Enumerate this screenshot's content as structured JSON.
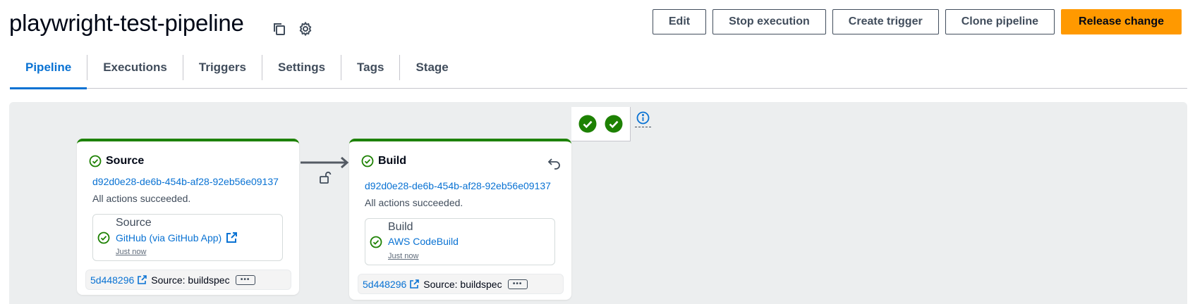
{
  "header": {
    "title": "playwright-test-pipeline",
    "actions": {
      "edit": "Edit",
      "stop": "Stop execution",
      "create_trigger": "Create trigger",
      "clone": "Clone pipeline",
      "release": "Release change"
    }
  },
  "tabs": [
    "Pipeline",
    "Executions",
    "Triggers",
    "Settings",
    "Tags",
    "Stage"
  ],
  "active_tab": "Pipeline",
  "stages": [
    {
      "name": "Source",
      "execution_id": "d92d0e28-de6b-454b-af28-92eb56e09137",
      "status": "All actions succeeded.",
      "action": {
        "name": "Source",
        "provider": "GitHub (via GitHub App)",
        "time": "Just now"
      },
      "revision": {
        "id": "5d448296",
        "label": "Source: buildspec"
      }
    },
    {
      "name": "Build",
      "execution_id": "d92d0e28-de6b-454b-af28-92eb56e09137",
      "status": "All actions succeeded.",
      "action": {
        "name": "Build",
        "provider": "AWS CodeBuild",
        "time": "Just now"
      },
      "revision": {
        "id": "5d448296",
        "label": "Source: buildspec"
      }
    }
  ],
  "icons": {
    "copy": "copy-icon",
    "settings": "gear-icon",
    "success": "check-circle-icon",
    "external": "external-link-icon",
    "retry": "retry-icon",
    "lock": "unlock-icon",
    "info": "info-icon"
  },
  "colors": {
    "primary": "#ff9900",
    "link": "#0972d3",
    "success": "#1d8102",
    "canvas": "#eceeef"
  }
}
